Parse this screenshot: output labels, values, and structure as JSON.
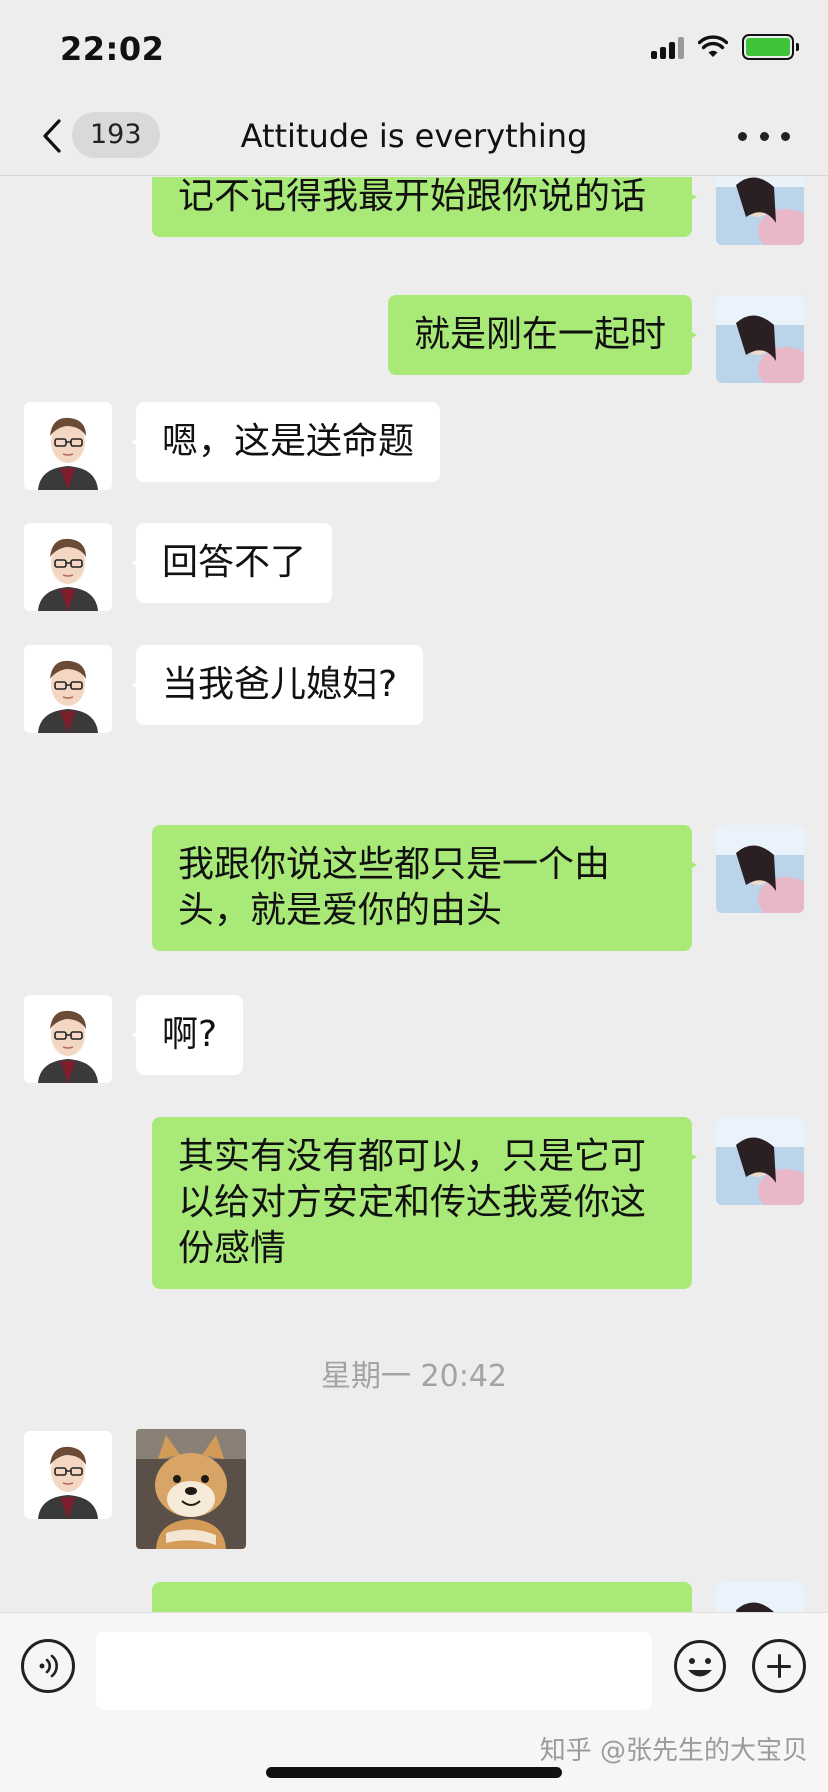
{
  "status_bar": {
    "time": "22:02",
    "battery_color": "#3ec43a"
  },
  "nav": {
    "back_icon": "chevron-left-icon",
    "unread_count": "193",
    "title": "Attitude is everything",
    "more_icon": "more-dots-icon"
  },
  "messages": [
    {
      "side": "self",
      "text": "记不记得我最开始跟你说的话"
    },
    {
      "side": "self",
      "text": "就是刚在一起时"
    },
    {
      "side": "other",
      "text": "嗯，这是送命题"
    },
    {
      "side": "other",
      "text": "回答不了"
    },
    {
      "side": "other",
      "text": "当我爸儿媳妇?"
    },
    {
      "side": "self",
      "text": "我跟你说这些都只是一个由头，就是爱你的由头"
    },
    {
      "side": "other",
      "text": "啊?"
    },
    {
      "side": "self",
      "text": "其实有没有都可以，只是它可以给对方安定和传达我爱你这份感情"
    },
    {
      "side": "timestamp",
      "text": "星期一 20:42"
    },
    {
      "side": "other",
      "type": "sticker",
      "sticker_icon": "shiba-dog-sticker"
    },
    {
      "side": "self",
      "text": ""
    }
  ],
  "input_bar": {
    "voice_icon": "voice-icon",
    "emoji_icon": "emoji-icon",
    "plus_icon": "plus-icon",
    "placeholder": ""
  },
  "watermark": "知乎 @张先生的大宝贝",
  "colors": {
    "self_bubble": "#a9e978",
    "other_bubble": "#ffffff",
    "background": "#ededed"
  }
}
